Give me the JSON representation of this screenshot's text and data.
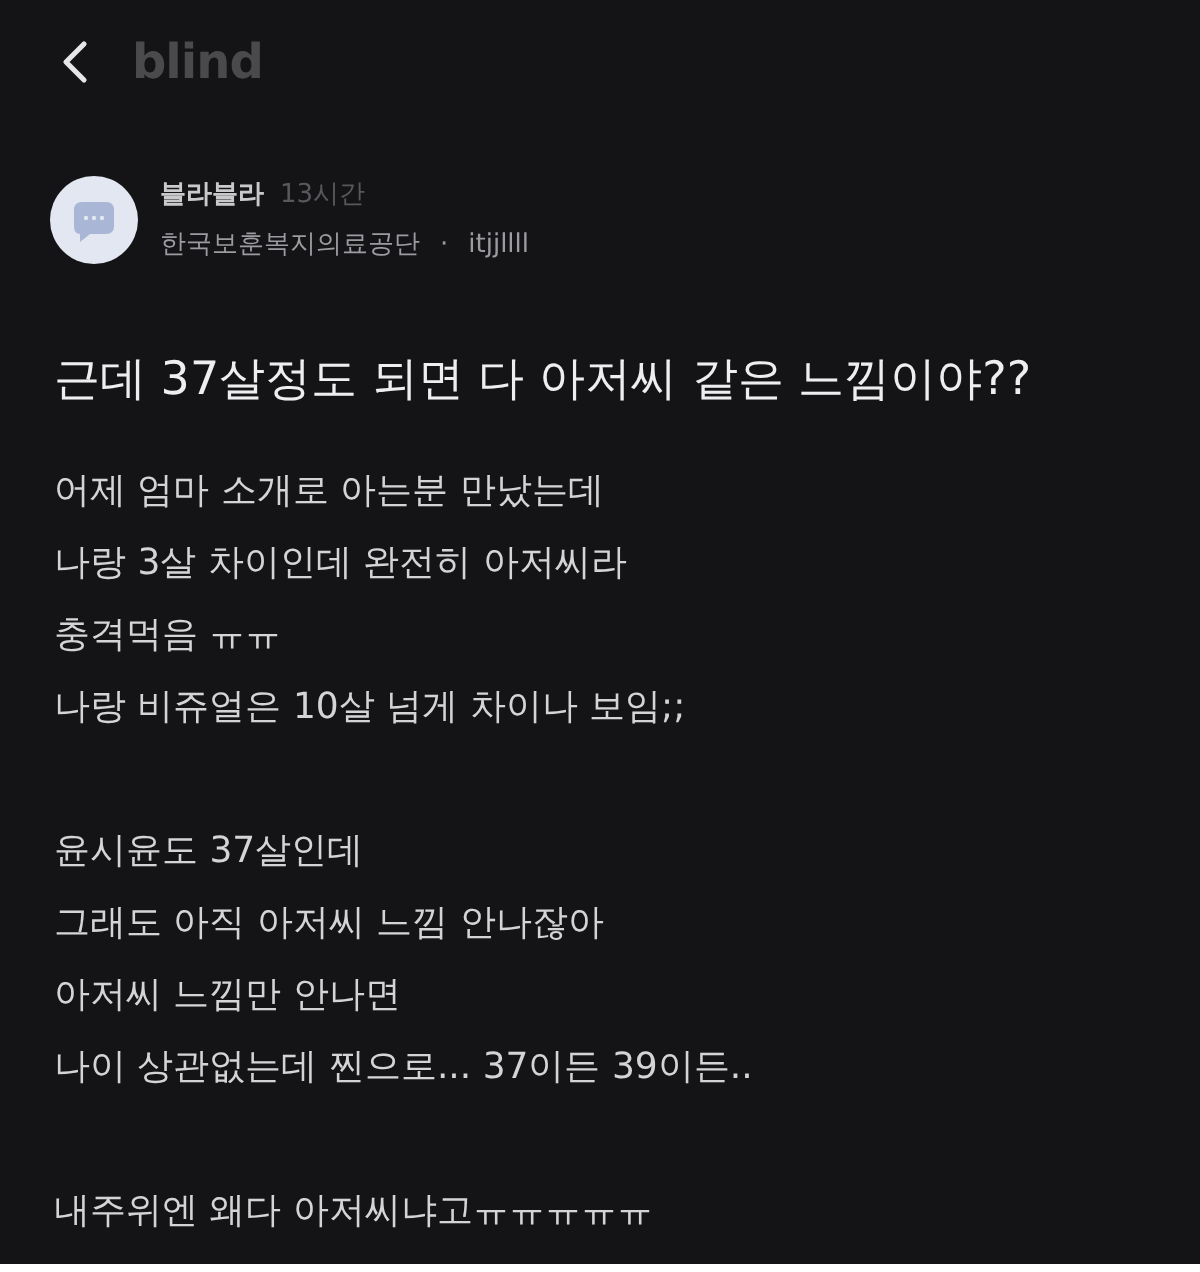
{
  "header": {
    "logo": "blind"
  },
  "post": {
    "author": "블라블라",
    "time": "13시간",
    "company": "한국보훈복지의료공단",
    "separator": "·",
    "nickname": "itjjllll",
    "title": "근데 37살정도 되면 다 아저씨 같은 느낌이야??",
    "paragraphs": [
      [
        "어제 엄마 소개로 아는분 만났는데",
        "나랑 3살 차이인데 완전히 아저씨라",
        "충격먹음 ㅠㅠ",
        "나랑 비쥬얼은 10살 넘게 차이나 보임;;"
      ],
      [
        "윤시윤도 37살인데",
        "그래도 아직 아저씨 느낌 안나잖아",
        "아저씨 느낌만 안나면",
        "나이 상관없는데 찐으로... 37이든 39이든.."
      ],
      [
        "내주위엔 왜다 아저씨냐고ㅠㅠㅠㅠㅠ"
      ]
    ]
  }
}
